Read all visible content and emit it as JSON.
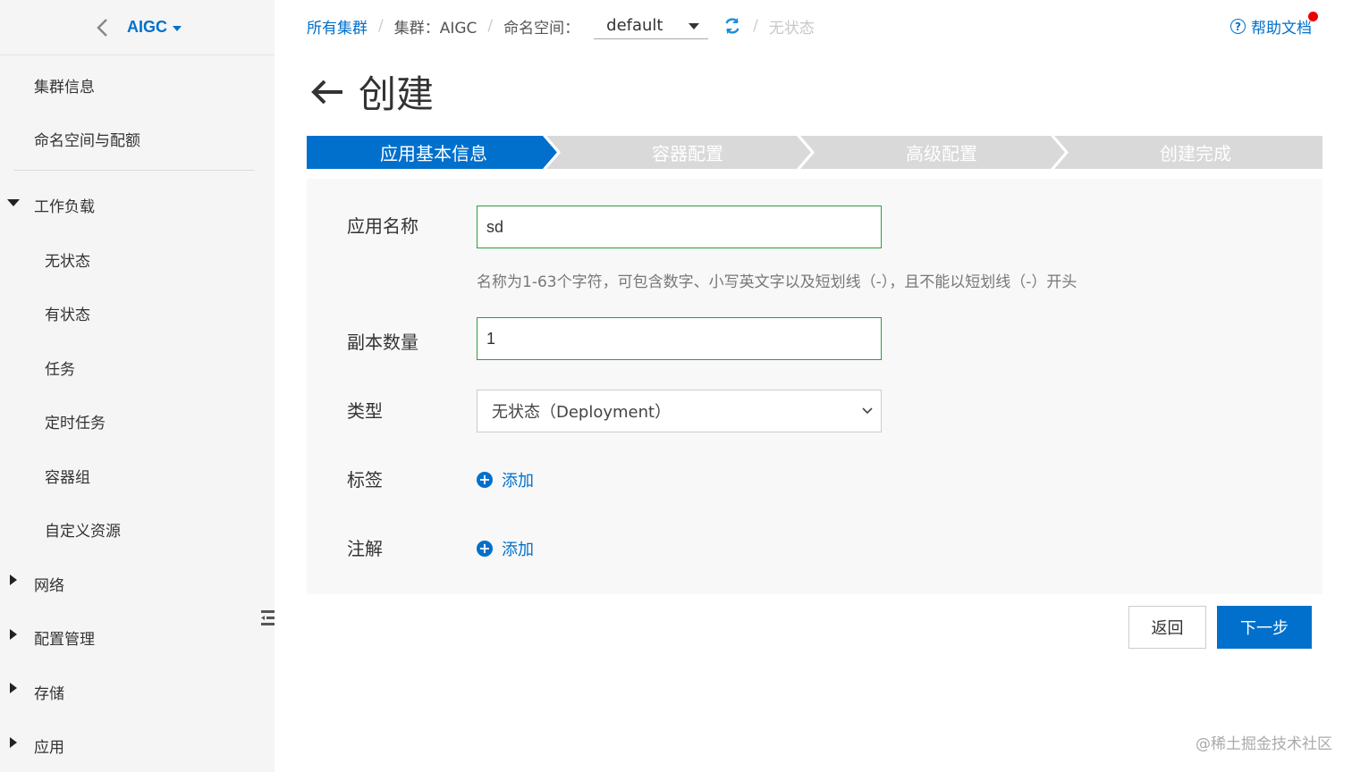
{
  "sidebar": {
    "cluster_name": "AIGC",
    "items": [
      {
        "label": "集群信息"
      },
      {
        "label": "命名空间与配额"
      },
      {
        "label": "工作负载"
      },
      {
        "label": "无状态"
      },
      {
        "label": "有状态"
      },
      {
        "label": "任务"
      },
      {
        "label": "定时任务"
      },
      {
        "label": "容器组"
      },
      {
        "label": "自定义资源"
      },
      {
        "label": "网络"
      },
      {
        "label": "配置管理"
      },
      {
        "label": "存储"
      },
      {
        "label": "应用"
      }
    ]
  },
  "breadcrumb": {
    "all_clusters": "所有集群",
    "cluster": "集群：AIGC",
    "namespace_label": "命名空间：",
    "namespace_value": "default",
    "current": "无状态"
  },
  "help": {
    "label": "帮助文档"
  },
  "page": {
    "title": "创建"
  },
  "steps": [
    {
      "label": "应用基本信息",
      "active": true
    },
    {
      "label": "容器配置",
      "active": false
    },
    {
      "label": "高级配置",
      "active": false
    },
    {
      "label": "创建完成",
      "active": false
    }
  ],
  "form": {
    "app_name": {
      "label": "应用名称",
      "value": "sd"
    },
    "hint": "名称为1-63个字符，可包含数字、小写英文字以及短划线（-），且不能以短划线（-）开头",
    "replicas": {
      "label": "副本数量",
      "value": "1"
    },
    "type": {
      "label": "类型",
      "value": "无状态（Deployment）"
    },
    "labels": {
      "label": "标签",
      "add": "添加"
    },
    "annotations": {
      "label": "注解",
      "add": "添加"
    }
  },
  "buttons": {
    "back": "返回",
    "next": "下一步"
  },
  "watermark": "@稀土掘金技术社区",
  "colors": {
    "accent": "#0070cc",
    "step_inactive": "#d9d9d9",
    "valid_border": "#2e9e3a"
  }
}
